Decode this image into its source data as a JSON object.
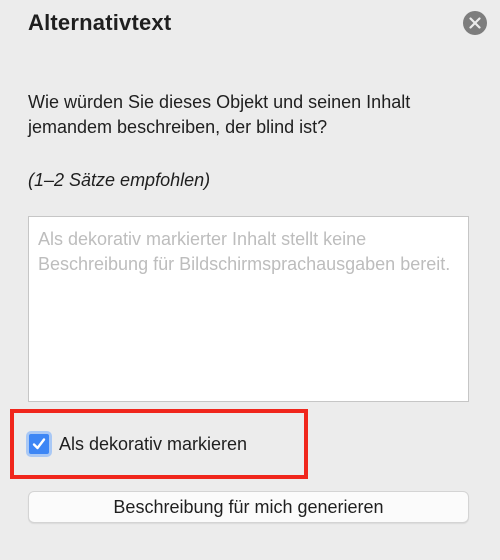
{
  "panel": {
    "title": "Alternativtext",
    "close_icon": "close-circle-icon"
  },
  "prompt": {
    "question": "Wie würden Sie dieses Objekt und seinen Inhalt jemandem beschreiben, der blind ist?",
    "hint": "(1–2 Sätze empfohlen)"
  },
  "description_field": {
    "value": "",
    "placeholder": "Als dekorativ markierter Inhalt stellt keine Beschreibung für Bildschirmsprachausgaben bereit."
  },
  "decorative_checkbox": {
    "label": "Als dekorativ markieren",
    "checked": true,
    "highlighted": true
  },
  "generate_button": {
    "label": "Beschreibung für mich generieren"
  },
  "colors": {
    "background": "#ececec",
    "checkbox_accent": "#3d86f5",
    "highlight": "#f0261c",
    "close_button": "#7d7d7d",
    "placeholder_text": "#bdbdbd"
  }
}
